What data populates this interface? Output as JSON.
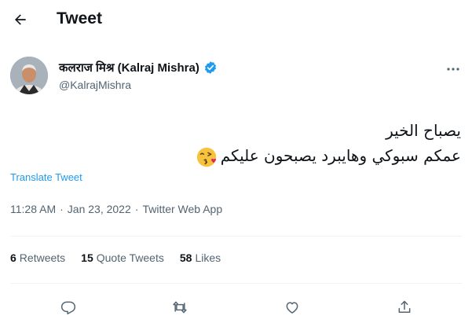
{
  "header": {
    "title": "Tweet",
    "back_icon": "arrow-left-icon"
  },
  "author": {
    "name": "कलराज मिश्र (Kalraj Mishra)",
    "handle": "@KalrajMishra",
    "verified": true,
    "more_icon": "more-horizontal-icon"
  },
  "tweet": {
    "lines": [
      "يصباح الخير",
      "عمكم سبوكي وهايبرد يصبحون عليكم"
    ],
    "emoji": "face-blowing-kiss",
    "translate_label": "Translate Tweet"
  },
  "meta": {
    "time": "11:28 AM",
    "separator1": "·",
    "date": "Jan 23, 2022",
    "separator2": "·",
    "source": "Twitter Web App"
  },
  "stats": {
    "retweets": {
      "count": "6",
      "label": "Retweets"
    },
    "quotes": {
      "count": "15",
      "label": "Quote Tweets"
    },
    "likes": {
      "count": "58",
      "label": "Likes"
    }
  },
  "actions": {
    "reply_icon": "reply-icon",
    "retweet_icon": "retweet-icon",
    "like_icon": "heart-icon",
    "share_icon": "share-icon"
  },
  "colors": {
    "accent": "#1d9bf0",
    "text": "#0f1419",
    "secondary": "#536471",
    "divider": "#eff3f4"
  }
}
